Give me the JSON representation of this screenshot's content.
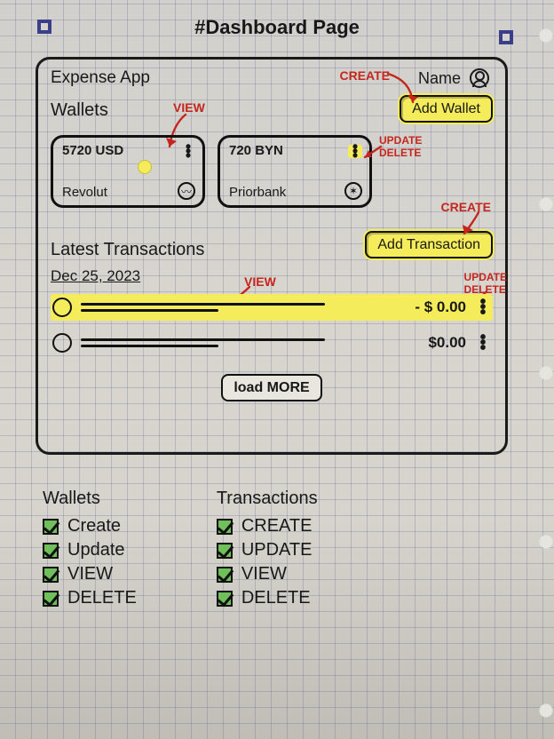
{
  "page_title": "#Dashboard   Page",
  "app_name": "Expense App",
  "user_label": "Name",
  "wallets": {
    "heading": "Wallets",
    "add_btn": "Add Wallet",
    "cards": [
      {
        "balance": "5720 USD",
        "bank": "Revolut"
      },
      {
        "balance": "720 BYN",
        "bank": "Priorbank"
      }
    ]
  },
  "transactions": {
    "heading": "Latest  Transactions",
    "add_btn": "Add Transaction",
    "date": "Dec 25, 2023",
    "rows": [
      {
        "amount": "- $ 0.00"
      },
      {
        "amount": "$0.00"
      }
    ],
    "load_more": "load MORE"
  },
  "annotations": {
    "create": "CREATE",
    "view": "VIEW",
    "update_delete": "UPDATE\nDELETE"
  },
  "crud": {
    "wallets_h": "Wallets",
    "transactions_h": "Transactions",
    "wallet_ops": [
      "Create",
      "Update",
      "VIEW",
      "DELETE"
    ],
    "transaction_ops": [
      "CREATE",
      "UPDATE",
      "VIEW",
      "DELETE"
    ]
  }
}
